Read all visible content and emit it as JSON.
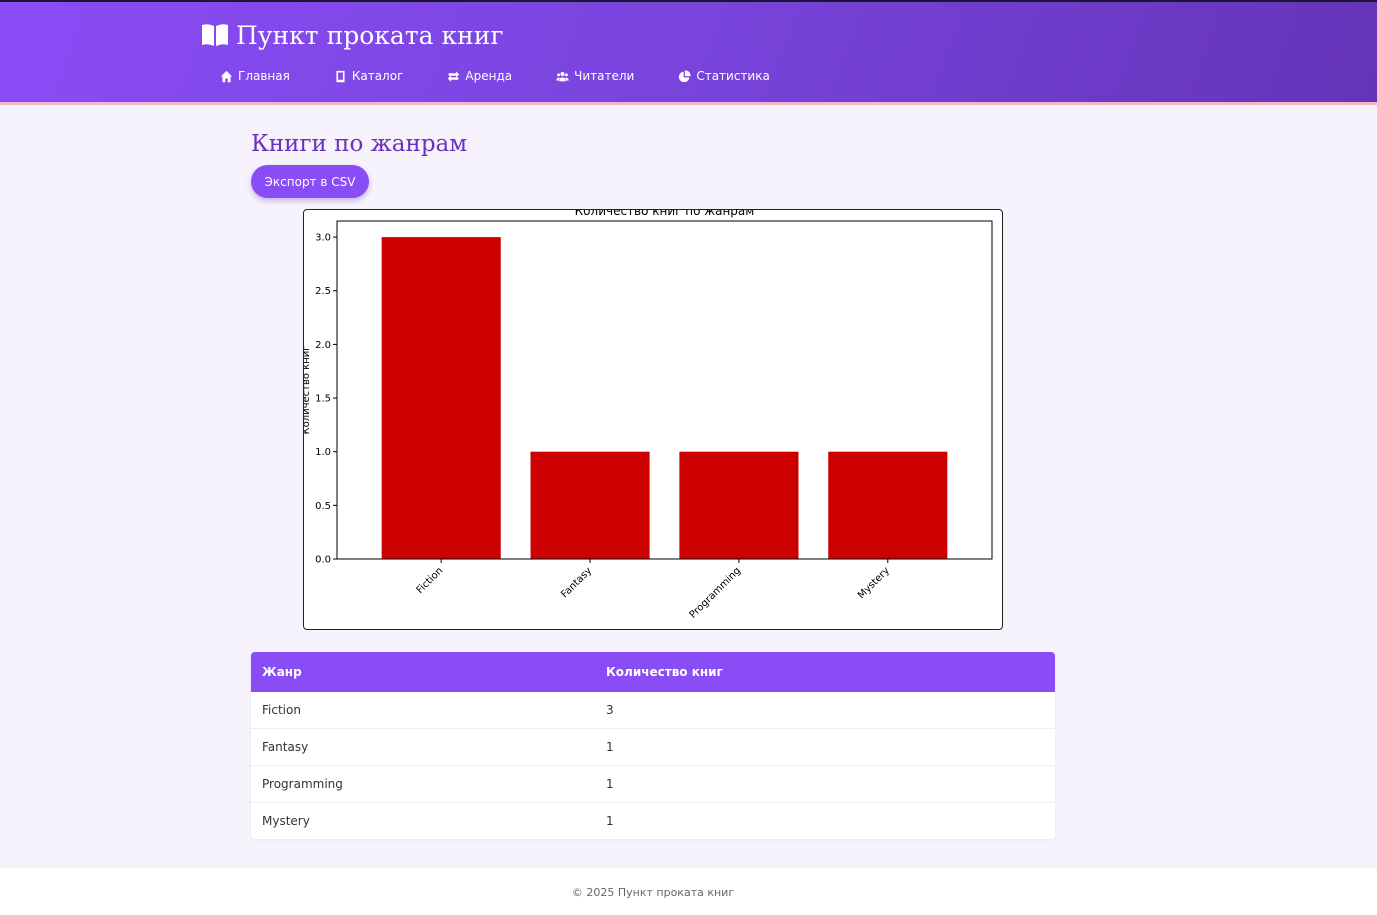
{
  "header": {
    "title": "Пункт проката книг",
    "nav": [
      {
        "label": "Главная",
        "icon": "home-icon"
      },
      {
        "label": "Каталог",
        "icon": "book-icon"
      },
      {
        "label": "Аренда",
        "icon": "exchange-icon"
      },
      {
        "label": "Читатели",
        "icon": "users-icon"
      },
      {
        "label": "Статистика",
        "icon": "chart-pie-icon"
      }
    ]
  },
  "page": {
    "title": "Книги по жанрам",
    "export_label": "Экспорт в CSV"
  },
  "colors": {
    "accent": "#8a4cf5",
    "bar": "#cc0000",
    "title": "#6a31c0"
  },
  "chart_data": {
    "type": "bar",
    "title": "Количество книг по жанрам",
    "ylabel": "Количество книг",
    "xlabel": "",
    "categories": [
      "Fiction",
      "Fantasy",
      "Programming",
      "Mystery"
    ],
    "values": [
      3,
      1,
      1,
      1
    ],
    "ylim": [
      0,
      3.15
    ],
    "yticks": [
      "0.0",
      "0.5",
      "1.0",
      "1.5",
      "2.0",
      "2.5",
      "3.0"
    ],
    "grid": false
  },
  "table": {
    "headers": [
      "Жанр",
      "Количество книг"
    ],
    "rows": [
      [
        "Fiction",
        "3"
      ],
      [
        "Fantasy",
        "1"
      ],
      [
        "Programming",
        "1"
      ],
      [
        "Mystery",
        "1"
      ]
    ]
  },
  "footer": {
    "copyright": "© 2025 Пункт проката книг"
  }
}
